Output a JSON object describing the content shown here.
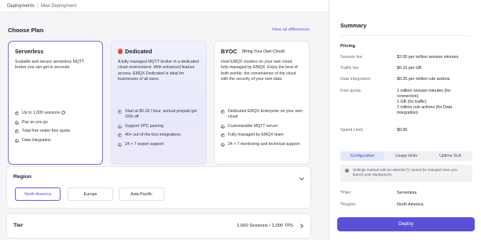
{
  "breadcrumb": {
    "root": "Deployments",
    "separator": "|",
    "current": "New Deployment"
  },
  "choose_plan": {
    "title": "Choose Plan",
    "view_all": "View all differences",
    "plans": [
      {
        "name": "Serverless",
        "subtitle": "",
        "description": "Scalable and secure serverless MQTT broker you can get in seconds.",
        "features": [
          "Up to 1,000 sessions",
          "Pay as you go",
          "Total free under free quota",
          "Data Integration"
        ]
      },
      {
        "name": "Dedicated",
        "subtitle": "",
        "description": "A fully managed MQTT broker in a dedicated cloud environment. With enhanced feature access, EMQX Dedicated is ideal for businesses of all sizes.",
        "features": [
          "Start at $0.18 / hour, annual prepaid get 15% off",
          "Support VPC peering",
          "40+ out-of-the-box integrations",
          "24 × 7 expert support"
        ]
      },
      {
        "name": "BYOC",
        "subtitle": "(Bring Your Own Cloud)",
        "description": "Host EMQX clusters on your own cloud, fully-managed by EMQX. Enjoy the best of both worlds: the convenience of the cloud with the security of your own data.",
        "features": [
          "Dedicated EMQX Enterprise on your own cloud",
          "Customizable MQTT server",
          "Fully managed by EMQX team",
          "24 × 7 monitoring and technical support"
        ]
      }
    ]
  },
  "region": {
    "title": "Region",
    "options": [
      "North America",
      "Europe",
      "Asia-Pacific"
    ],
    "selected": "North America"
  },
  "tier": {
    "title": "Tier",
    "value": "1,000 Sessions / 1,000 TPS"
  },
  "summary": {
    "title": "Summary",
    "pricing_label": "Pricing",
    "rows": [
      {
        "key": "Session fee:",
        "value": "$2.00 per million session minutes"
      },
      {
        "key": "Traffic fee:",
        "value": "$0.15 per GB"
      },
      {
        "key": "Data Integration:",
        "value": "$0.25 per million rule actions"
      },
      {
        "key": "Free quota:",
        "value": "1 million session minutes (for connection)",
        "value2": "1 GB (for traffic)",
        "value3": "1 million rule actions (for Data Integration)"
      },
      {
        "key": "Spend Limit:",
        "value": "$0.00"
      }
    ],
    "tabs": [
      "Configuration",
      "Usage limits",
      "Uptime SLA"
    ],
    "active_tab": "Configuration",
    "notice": "Settings marked with an asterisk (*) cannot be changed once you launch your deployment.",
    "config": [
      {
        "key": "*Plan:",
        "value": "Serverless"
      },
      {
        "key": "*Region:",
        "value": "North America"
      }
    ],
    "deploy_label": "Deploy"
  },
  "colors": {
    "accent": "#5b4fd6",
    "selected_border": "#7b6ee0",
    "dedicated_icon": "#e5472d"
  }
}
